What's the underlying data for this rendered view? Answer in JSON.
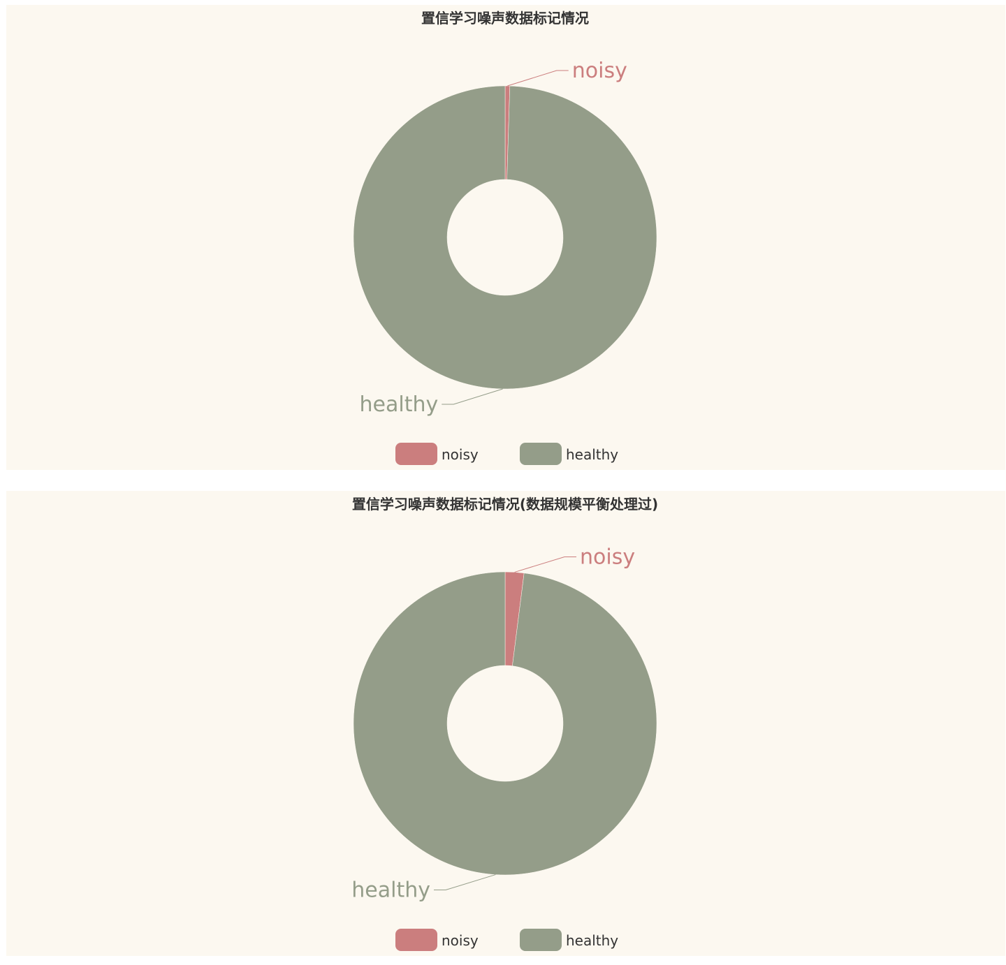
{
  "colors": {
    "background": "#fcf8f0",
    "noisy": "#cb7e7e",
    "healthy": "#949d89",
    "title": "#333333"
  },
  "chart_data": [
    {
      "type": "pie",
      "variant": "donut",
      "title": "置信学习噪声数据标记情况",
      "categories": [
        "noisy",
        "healthy"
      ],
      "values": [
        0.5,
        99.5
      ],
      "legend": [
        "noisy",
        "healthy"
      ],
      "legend_position": "bottom-center",
      "labels": [
        "noisy",
        "healthy"
      ]
    },
    {
      "type": "pie",
      "variant": "donut",
      "title": "置信学习噪声数据标记情况(数据规模平衡处理过)",
      "categories": [
        "noisy",
        "healthy"
      ],
      "values": [
        2,
        98
      ],
      "legend": [
        "noisy",
        "healthy"
      ],
      "legend_position": "bottom-center",
      "labels": [
        "noisy",
        "healthy"
      ]
    }
  ]
}
